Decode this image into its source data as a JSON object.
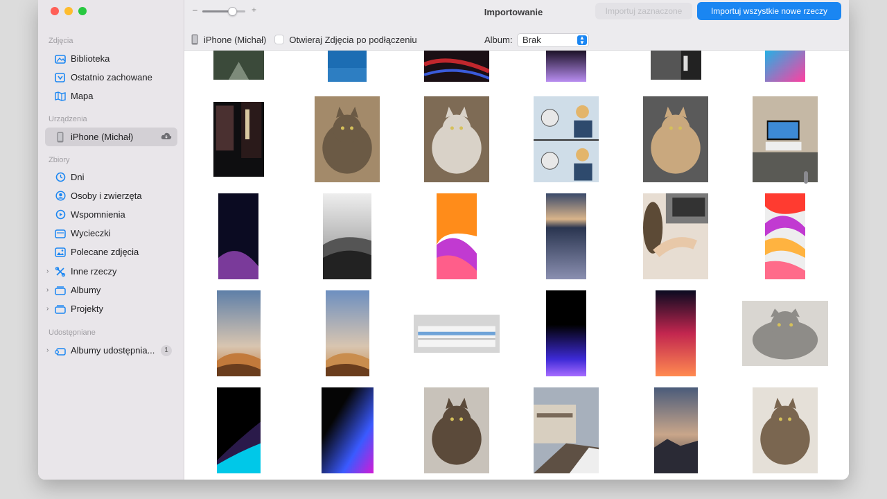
{
  "window": {
    "title": "Importowanie"
  },
  "toolbar": {
    "zoom_minus": "–",
    "zoom_plus": "+",
    "zoom_level": 0.7,
    "import_selected_label": "Importuj zaznaczone",
    "import_all_label": "Importuj wszystkie nowe rzeczy",
    "device_name": "iPhone (Michał)",
    "open_photos_label": "Otwieraj Zdjęcia po podłączeniu",
    "open_photos_checked": false,
    "album_label": "Album:",
    "album_value": "Brak"
  },
  "sidebar": {
    "sections": [
      {
        "title": "Zdjęcia",
        "items": [
          {
            "label": "Biblioteka",
            "icon": "photo-library-icon"
          },
          {
            "label": "Ostatnio zachowane",
            "icon": "recently-saved-icon"
          },
          {
            "label": "Mapa",
            "icon": "map-icon"
          }
        ]
      },
      {
        "title": "Urządzenia",
        "items": [
          {
            "label": "iPhone (Michał)",
            "icon": "iphone-icon",
            "selected": true,
            "extra": "cloud-icon"
          }
        ]
      },
      {
        "title": "Zbiory",
        "items": [
          {
            "label": "Dni",
            "icon": "clock-icon"
          },
          {
            "label": "Osoby i zwierzęta",
            "icon": "person-circle-icon"
          },
          {
            "label": "Wspomnienia",
            "icon": "memories-icon"
          },
          {
            "label": "Wycieczki",
            "icon": "trips-icon"
          },
          {
            "label": "Polecane zdjęcia",
            "icon": "featured-photos-icon"
          },
          {
            "label": "Inne rzeczy",
            "icon": "other-things-icon",
            "disclosure": true
          },
          {
            "label": "Albumy",
            "icon": "albums-icon",
            "disclosure": true
          },
          {
            "label": "Projekty",
            "icon": "projects-icon",
            "disclosure": true
          }
        ]
      },
      {
        "title": "Udostępniane",
        "items": [
          {
            "label": "Albumy udostępnia...",
            "icon": "shared-albums-icon",
            "disclosure": true,
            "badge": "1"
          }
        ]
      }
    ]
  },
  "colors": {
    "accent": "#1a86f2",
    "sidebar_bg": "#e9e6ea",
    "toolbar_bg": "#ecebee",
    "traffic_red": "#ff5f57",
    "traffic_yellow": "#febc2e",
    "traffic_green": "#28c840"
  },
  "photos": [
    {
      "name": "photo-street-night",
      "c1": "#3b4a3a",
      "c2": "#7d8b7a",
      "style": "street"
    },
    {
      "name": "photo-blue-wallpaper",
      "c1": "#1c6db3",
      "c2": "#3d8fd1",
      "style": "solid"
    },
    {
      "name": "photo-red-neon",
      "c1": "#1a0f14",
      "c2": "#c1272d",
      "style": "neon"
    },
    {
      "name": "photo-purple-horizon",
      "c1": "#0a0410",
      "c2": "#b88df0",
      "style": "horizon"
    },
    {
      "name": "photo-cobblestone",
      "c1": "#555",
      "c2": "#999",
      "style": "stone"
    },
    {
      "name": "photo-cyan-pink",
      "c1": "#19b6e8",
      "c2": "#ff3fa0",
      "style": "duo"
    },
    {
      "name": "photo-dark-alley",
      "c1": "#2a1a1a",
      "c2": "#4a3030",
      "style": "alley"
    },
    {
      "name": "photo-cat-face",
      "c1": "#6b5a45",
      "c2": "#a38a6a",
      "style": "cat"
    },
    {
      "name": "photo-cat-sleeping",
      "c1": "#d9d2c8",
      "c2": "#7e6b55",
      "style": "catbed"
    },
    {
      "name": "photo-meme-comic",
      "c1": "#cfdde8",
      "c2": "#2e4a6d",
      "style": "meme"
    },
    {
      "name": "photo-cat-keyboard",
      "c1": "#c9a87e",
      "c2": "#5a5a5a",
      "style": "catkb"
    },
    {
      "name": "photo-living-room-tv",
      "c1": "#8a7b67",
      "c2": "#c5b8a5",
      "style": "room"
    },
    {
      "name": "photo-wallpaper-night-flowers",
      "c1": "#0b0b22",
      "c2": "#7a3a9a",
      "style": "nightflower"
    },
    {
      "name": "photo-wallpaper-grey-mountains",
      "c1": "#eeeeee",
      "c2": "#222222",
      "style": "mountains"
    },
    {
      "name": "photo-wallpaper-orange-waves",
      "c1": "#ff8c1a",
      "c2": "#c13ad1",
      "style": "waves"
    },
    {
      "name": "photo-wallpaper-clouds",
      "c1": "#2a3550",
      "c2": "#8a8fb0",
      "style": "clouds"
    },
    {
      "name": "photo-hand-laptop",
      "c1": "#7a7a7a",
      "c2": "#e7ddd2",
      "style": "handlaptop"
    },
    {
      "name": "photo-wallpaper-colorful-waves",
      "c1": "#ff3b30",
      "c2": "#ffb340",
      "style": "colorwaves"
    },
    {
      "name": "photo-mojave-day",
      "c1": "#5e7fa8",
      "c2": "#c27a3b",
      "style": "mojave"
    },
    {
      "name": "photo-mojave-light",
      "c1": "#6d8fc0",
      "c2": "#c98d4e",
      "style": "mojave"
    },
    {
      "name": "photo-screenshot-table",
      "c1": "#d5d5d5",
      "c2": "#6fa3d8",
      "style": "table"
    },
    {
      "name": "photo-wallpaper-purple-glow",
      "c1": "#000000",
      "c2": "#a66cff",
      "style": "glow"
    },
    {
      "name": "photo-wallpaper-sunset-gradient",
      "c1": "#0a0a20",
      "c2": "#ff8a50",
      "style": "sunset"
    },
    {
      "name": "photo-cat-peeking",
      "c1": "#8e8c88",
      "c2": "#d9d6d1",
      "style": "catpeek"
    },
    {
      "name": "photo-wallpaper-cyan-wave",
      "c1": "#000000",
      "c2": "#00c8e8",
      "style": "cyanwave"
    },
    {
      "name": "photo-wallpaper-blue-magenta",
      "c1": "#050505",
      "c2": "#d21ad6",
      "style": "bluemag"
    },
    {
      "name": "photo-cat-on-jeans",
      "c1": "#5b4a3a",
      "c2": "#c8c2ba",
      "style": "catjeans"
    },
    {
      "name": "photo-city-street",
      "c1": "#a7b0bc",
      "c2": "#5e5044",
      "style": "city"
    },
    {
      "name": "photo-wallpaper-dusk-mountains",
      "c1": "#4a5b7a",
      "c2": "#2a2a35",
      "style": "dusk"
    },
    {
      "name": "photo-cat-paper",
      "c1": "#7a6650",
      "c2": "#e5e0d8",
      "style": "catpaper"
    }
  ]
}
